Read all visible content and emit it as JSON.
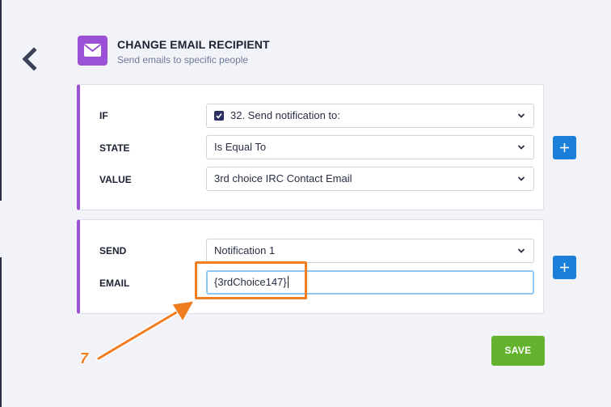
{
  "header": {
    "title": "CHANGE EMAIL RECIPIENT",
    "subtitle": "Send emails to specific people",
    "icon": "envelope-icon"
  },
  "condition": {
    "if_label": "IF",
    "if_value": "32. Send notification to:",
    "state_label": "STATE",
    "state_value": "Is Equal To",
    "value_label": "VALUE",
    "value_value": "3rd choice IRC Contact Email"
  },
  "action": {
    "send_label": "SEND",
    "send_value": "Notification 1",
    "email_label": "EMAIL",
    "email_value": "{3rdChoice147}"
  },
  "save_label": "SAVE",
  "annotation": {
    "step": "7"
  },
  "colors": {
    "accent": "#9b51d6",
    "primary": "#1a7fd8",
    "save": "#63b32e",
    "annotation": "#f07d1f"
  }
}
